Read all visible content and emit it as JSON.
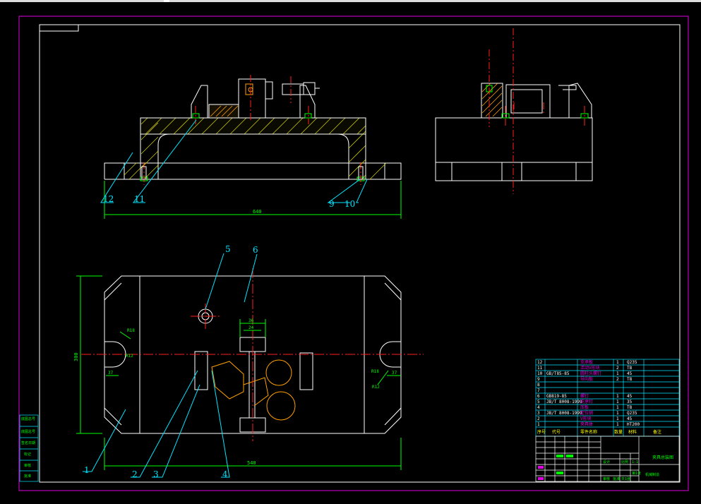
{
  "drawing": {
    "balloons_top": [
      "12",
      "11",
      "9",
      "10"
    ],
    "balloons_plan": [
      "5",
      "6",
      "1",
      "2",
      "3",
      "4"
    ],
    "dim_top_length": "640",
    "dim_plan_length": "540",
    "dim_plan_height": "300",
    "dim_center_width": "36",
    "dim_center_inner": "24",
    "dim_left_radius": "R18",
    "dim_left_angle": "R12",
    "dim_left_offset": "37",
    "dim_right_radius": "R18",
    "dim_right_angle": "R12",
    "dim_right_offset": "37"
  },
  "parts_list": {
    "rows": [
      {
        "no": "12",
        "code": "",
        "name": "支承板",
        "qty": "1",
        "mat": "Q235"
      },
      {
        "no": "11",
        "code": "",
        "name": "活动V形块",
        "qty": "2",
        "mat": "T8"
      },
      {
        "no": "10",
        "code": "GB/T85-85",
        "name": "圆柱头螺钉",
        "qty": "1",
        "mat": "45"
      },
      {
        "no": "9",
        "code": "",
        "name": "导向板",
        "qty": "2",
        "mat": "T8"
      },
      {
        "no": "8",
        "code": "",
        "name": "",
        "qty": "",
        "mat": ""
      },
      {
        "no": "7",
        "code": "",
        "name": "",
        "qty": "",
        "mat": ""
      },
      {
        "no": "6",
        "code": "GB819-85",
        "name": "螺钉",
        "qty": "1",
        "mat": "45"
      },
      {
        "no": "5",
        "code": "JB/T 8008-1999",
        "name": "支承钉",
        "qty": "1",
        "mat": "35"
      },
      {
        "no": "4",
        "code": "",
        "name": "压板",
        "qty": "1",
        "mat": "T8"
      },
      {
        "no": "3",
        "code": "JB/T 8008-1999",
        "name": "定位销",
        "qty": "1",
        "mat": "Q235"
      },
      {
        "no": "2",
        "code": "",
        "name": "V形块",
        "qty": "1",
        "mat": "45"
      },
      {
        "no": "1",
        "code": "",
        "name": "夹具体",
        "qty": "1",
        "mat": "HT200"
      }
    ],
    "header": {
      "no": "序号",
      "code": "代号",
      "name": "零件名称",
      "qty": "数量",
      "mat": "材料",
      "note": "备注"
    }
  },
  "title_block": {
    "drawing_title": "夹具总装图",
    "scale_label": "比例",
    "scale_value": "1:1",
    "sheet_label": "共1张",
    "sheet_no": "第1张",
    "design_label": "设计",
    "check_label": "审核",
    "approve_label": "批准",
    "school": "机械制造"
  },
  "side_stamp": [
    "底图总号",
    "底图总号",
    "签名日期",
    "标记",
    "审核",
    "批准"
  ],
  "colors": {
    "outline": "#ffffff",
    "frame": "#e000e0",
    "centerline": "#ff2020",
    "dimension": "#00ff00",
    "leader": "#00e5ff",
    "hatch": "#ffff00",
    "part": "#ffa000"
  }
}
